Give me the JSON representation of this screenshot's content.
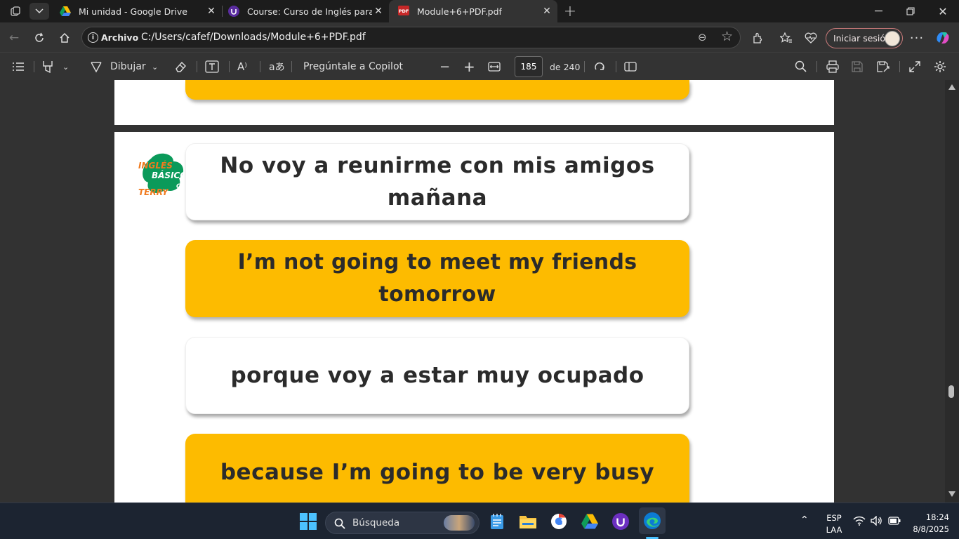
{
  "browser": {
    "tabs": [
      {
        "title": "Mi unidad - Google Drive",
        "icon": "google-drive-icon"
      },
      {
        "title": "Course: Curso de Inglés para principiantes",
        "icon": "udemy-icon"
      },
      {
        "title": "Module+6+PDF.pdf",
        "icon": "pdf-icon",
        "active": true
      }
    ],
    "address": {
      "security_label": "Archivo",
      "url": "C:/Users/cafef/Downloads/Module+6+PDF.pdf"
    },
    "signin_label": "Iniciar sesión"
  },
  "pdf_toolbar": {
    "draw_label": "Dibujar",
    "copilot_label": "Pregúntale a Copilot",
    "page_number": "185",
    "page_total": "de 240"
  },
  "document": {
    "logo_text": {
      "line1": "INGLÉS",
      "line2": "BÁSICO",
      "line3": "TERRY",
      "suffix": "CO"
    },
    "cards": [
      {
        "text": "No voy a reunirme con mis amigos mañana",
        "style": "white"
      },
      {
        "text": "I’m not going to meet my friends tomorrow",
        "style": "yellow"
      },
      {
        "text": "porque voy a estar muy ocupado",
        "style": "white"
      },
      {
        "text": "because I’m going to be very busy",
        "style": "yellow"
      }
    ],
    "colors": {
      "yellow": "#fdbb00",
      "text": "#2b2b2b"
    }
  },
  "taskbar": {
    "search_placeholder": "Búsqueda",
    "lang_line1": "ESP",
    "lang_line2": "LAA",
    "time": "18:24",
    "date": "8/8/2025"
  }
}
